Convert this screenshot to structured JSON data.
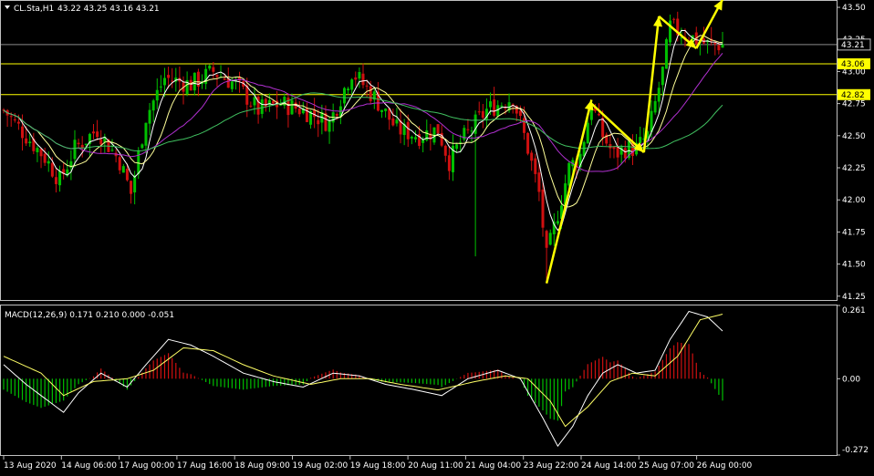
{
  "header": {
    "symbol_label": "CL.Sta,H1",
    "ohlc_text": "43.22 43.25 43.16 43.21"
  },
  "macd_panel": {
    "label": "MACD(12,26,9) 0.171 0.210 0.000 -0.051"
  },
  "colors": {
    "background": "#000000",
    "grid_frame": "#c0c0c0",
    "bull_candle": "#00c000",
    "bear_candle": "#d01010",
    "ma_fast": "#ffffff",
    "ma_mid": "#ffff99",
    "ma_purple": "#b030d0",
    "ma_green": "#40c060",
    "level_line": "#ffff00",
    "arrow": "#ffff00",
    "macd_signal": "#ffff66"
  },
  "chart_data": [
    {
      "type": "candlestick",
      "title": "CL.Sta,H1",
      "ylim": [
        41.22,
        43.55
      ],
      "y_ticks": [
        "43.50",
        "43.25",
        "43.00",
        "42.75",
        "42.50",
        "42.25",
        "42.00",
        "41.75",
        "41.50",
        "41.25"
      ],
      "price_labels": [
        {
          "label": "43.21",
          "value": 43.21,
          "style": "current"
        },
        {
          "label": "43.06",
          "value": 43.06,
          "style": "level"
        },
        {
          "label": "42.82",
          "value": 42.82,
          "style": "level"
        }
      ],
      "x_ticks": [
        "13 Aug 2020",
        "14 Aug 06:00",
        "17 Aug 00:00",
        "17 Aug 16:00",
        "18 Aug 09:00",
        "19 Aug 02:00",
        "19 Aug 18:00",
        "20 Aug 11:00",
        "21 Aug 04:00",
        "23 Aug 22:00",
        "24 Aug 14:00",
        "25 Aug 07:00",
        "26 Aug 00:00"
      ],
      "close_path": [
        [
          0,
          42.7
        ],
        [
          6,
          42.5
        ],
        [
          11,
          42.33
        ],
        [
          15,
          42.15
        ],
        [
          19,
          42.4
        ],
        [
          25,
          42.55
        ],
        [
          31,
          42.3
        ],
        [
          34,
          42.05
        ],
        [
          38,
          42.65
        ],
        [
          43,
          42.95
        ],
        [
          50,
          42.9
        ],
        [
          56,
          43.0
        ],
        [
          62,
          42.9
        ],
        [
          68,
          42.7
        ],
        [
          74,
          42.75
        ],
        [
          80,
          42.7
        ],
        [
          87,
          42.6
        ],
        [
          93,
          43.0
        ],
        [
          99,
          42.8
        ],
        [
          105,
          42.55
        ],
        [
          111,
          42.5
        ],
        [
          116,
          42.55
        ],
        [
          119,
          42.3
        ],
        [
          122,
          42.45
        ],
        [
          129,
          42.7
        ],
        [
          136,
          42.8
        ],
        [
          140,
          42.4
        ],
        [
          143,
          42.05
        ],
        [
          145,
          41.55
        ],
        [
          148,
          41.9
        ],
        [
          151,
          42.25
        ],
        [
          154,
          42.35
        ],
        [
          157,
          42.75
        ],
        [
          160,
          42.5
        ],
        [
          163,
          42.35
        ],
        [
          166,
          42.4
        ],
        [
          169,
          42.4
        ],
        [
          172,
          42.5
        ],
        [
          176,
          43.0
        ],
        [
          178,
          43.35
        ],
        [
          181,
          43.3
        ],
        [
          185,
          43.25
        ],
        [
          188,
          43.21
        ]
      ],
      "moving_averages": [
        {
          "color": "white"
        },
        {
          "color": "light yellow"
        },
        {
          "color": "purple"
        },
        {
          "color": "green"
        }
      ],
      "annotations": [
        {
          "type": "arrow",
          "from": [
            145,
            41.35
          ],
          "to": [
            157,
            42.78
          ]
        },
        {
          "type": "arrow",
          "from": [
            157,
            42.75
          ],
          "to": [
            171,
            42.37
          ]
        },
        {
          "type": "arrow",
          "from": [
            171,
            42.37
          ],
          "to": [
            175,
            43.43
          ]
        },
        {
          "type": "arrow",
          "from": [
            175,
            43.43
          ],
          "to": [
            185,
            43.18
          ]
        },
        {
          "type": "arrow",
          "from": [
            185,
            43.18
          ],
          "to": [
            192,
            43.56
          ]
        }
      ]
    },
    {
      "type": "macd",
      "title": "MACD(12,26,9)",
      "params": [
        12,
        26,
        9
      ],
      "values": {
        "macd": 0.171,
        "signal": 0.21,
        "histogram_a": 0.0,
        "histogram_b": -0.051
      },
      "ylim": [
        -0.272,
        0.261
      ],
      "y_ticks": [
        "0.261",
        "0.00",
        "-0.272"
      ],
      "macd_path": [
        [
          0,
          0.05
        ],
        [
          6,
          -0.02
        ],
        [
          12,
          -0.08
        ],
        [
          16,
          -0.12
        ],
        [
          20,
          -0.05
        ],
        [
          26,
          0.02
        ],
        [
          33,
          -0.03
        ],
        [
          38,
          0.05
        ],
        [
          44,
          0.14
        ],
        [
          50,
          0.12
        ],
        [
          56,
          0.08
        ],
        [
          64,
          0.02
        ],
        [
          72,
          -0.01
        ],
        [
          80,
          -0.03
        ],
        [
          88,
          0.02
        ],
        [
          95,
          0.01
        ],
        [
          102,
          -0.02
        ],
        [
          110,
          -0.04
        ],
        [
          117,
          -0.06
        ],
        [
          124,
          0.0
        ],
        [
          132,
          0.03
        ],
        [
          138,
          0.0
        ],
        [
          144,
          -0.14
        ],
        [
          148,
          -0.24
        ],
        [
          152,
          -0.17
        ],
        [
          156,
          -0.06
        ],
        [
          160,
          0.02
        ],
        [
          164,
          0.05
        ],
        [
          169,
          0.02
        ],
        [
          174,
          0.03
        ],
        [
          178,
          0.14
        ],
        [
          183,
          0.24
        ],
        [
          188,
          0.22
        ],
        [
          192,
          0.17
        ]
      ],
      "signal_path": [
        [
          0,
          0.08
        ],
        [
          10,
          0.02
        ],
        [
          16,
          -0.06
        ],
        [
          24,
          -0.01
        ],
        [
          33,
          0.0
        ],
        [
          40,
          0.03
        ],
        [
          48,
          0.11
        ],
        [
          56,
          0.1
        ],
        [
          64,
          0.05
        ],
        [
          72,
          0.01
        ],
        [
          82,
          -0.02
        ],
        [
          90,
          0.0
        ],
        [
          98,
          0.0
        ],
        [
          106,
          -0.02
        ],
        [
          116,
          -0.04
        ],
        [
          126,
          -0.01
        ],
        [
          134,
          0.01
        ],
        [
          140,
          0.0
        ],
        [
          146,
          -0.08
        ],
        [
          150,
          -0.17
        ],
        [
          156,
          -0.1
        ],
        [
          162,
          -0.01
        ],
        [
          168,
          0.02
        ],
        [
          174,
          0.01
        ],
        [
          180,
          0.08
        ],
        [
          186,
          0.21
        ],
        [
          192,
          0.23
        ]
      ]
    }
  ]
}
